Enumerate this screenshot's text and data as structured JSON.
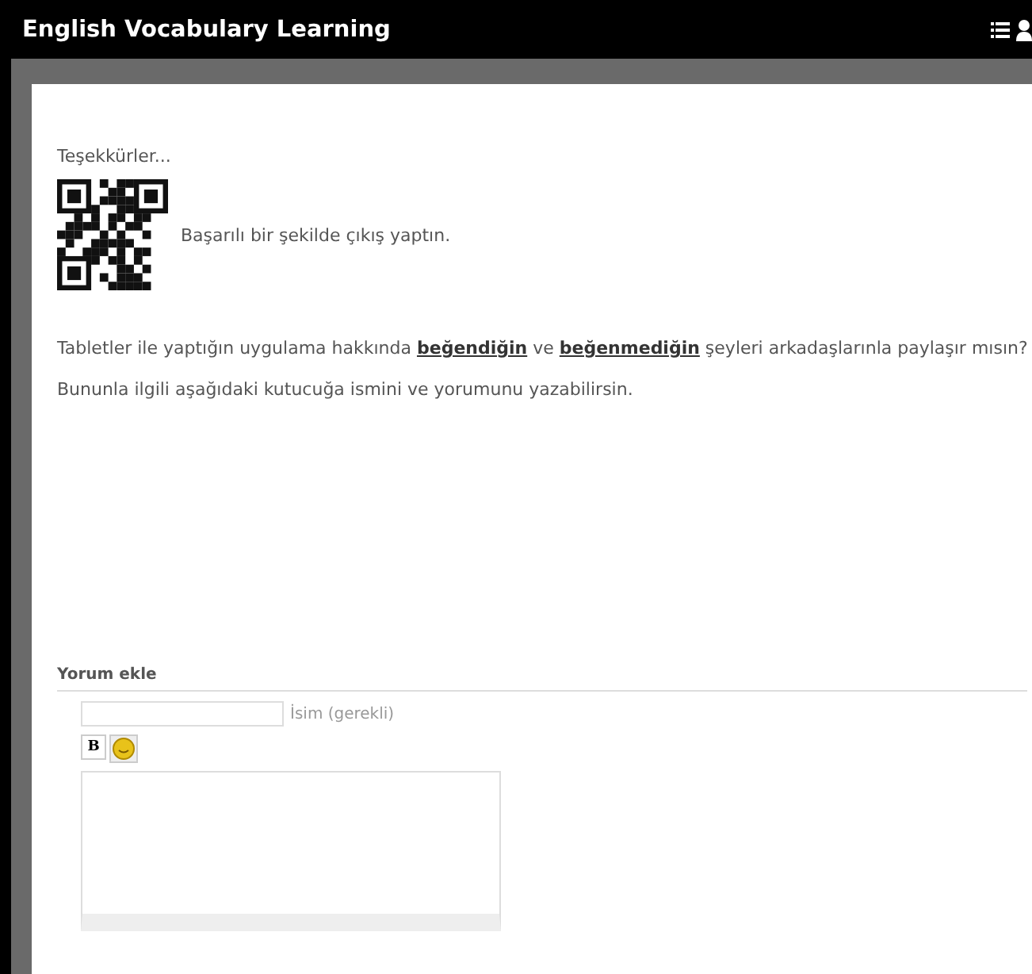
{
  "header": {
    "title": "English Vocabulary Learning"
  },
  "content": {
    "thanks": "Teşekkürler...",
    "status": "Başarılı bir şekilde çıkış yaptın.",
    "paragraphs": [
      "Tabletler ile yaptığın uygulama hakkında **beğendiğin** ve **beğenmediğin** şeyleri arkadaşlarınla paylaşır mısın?",
      "Bununla ilgili aşağıdaki kutucuğa ismini ve yorumunu yazabilirsin."
    ]
  },
  "comment_form": {
    "heading": "Yorum ekle",
    "name_label": "İsim (gerekli)",
    "bold_button": "B"
  }
}
